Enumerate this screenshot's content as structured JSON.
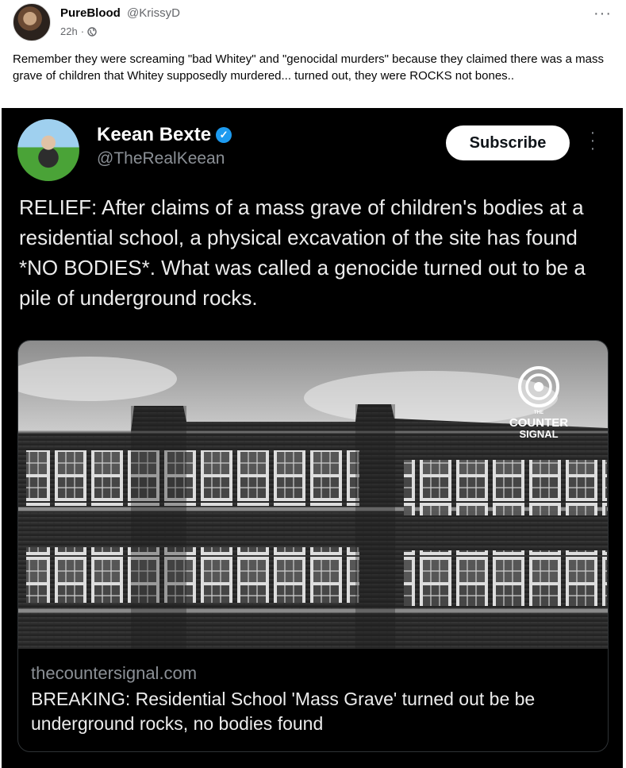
{
  "post": {
    "author_name": "PureBlood",
    "author_handle": "@KrissyD",
    "time": "22h",
    "separator": "·",
    "more": "···",
    "text": "Remember they were screaming \"bad Whitey\" and \"genocidal murders\" because they claimed there was a mass grave of children that Whitey supposedly murdered... turned out, they were ROCKS not bones.."
  },
  "embedded": {
    "name": "Keean Bexte",
    "handle": "@TheRealKeean",
    "verified_icon": "verified-check-icon",
    "subscribe_label": "Subscribe",
    "text": "RELIEF: After claims of a mass grave of children's bodies at a residential school, a physical excavation of the site has found *NO BODIES*. What was called a genocide turned out to be a pile of underground rocks.",
    "card": {
      "logo_text_1": "THE",
      "logo_text_2": "COUNTER",
      "logo_text_3": "SIGNAL",
      "domain": "thecountersignal.com",
      "title": "BREAKING: Residential School 'Mass Grave' turned out be be underground rocks, no bodies found"
    }
  },
  "colors": {
    "facebook_text": "#050505",
    "facebook_meta": "#65676b",
    "x_background": "#000000",
    "x_blue": "#1d9bf0"
  }
}
